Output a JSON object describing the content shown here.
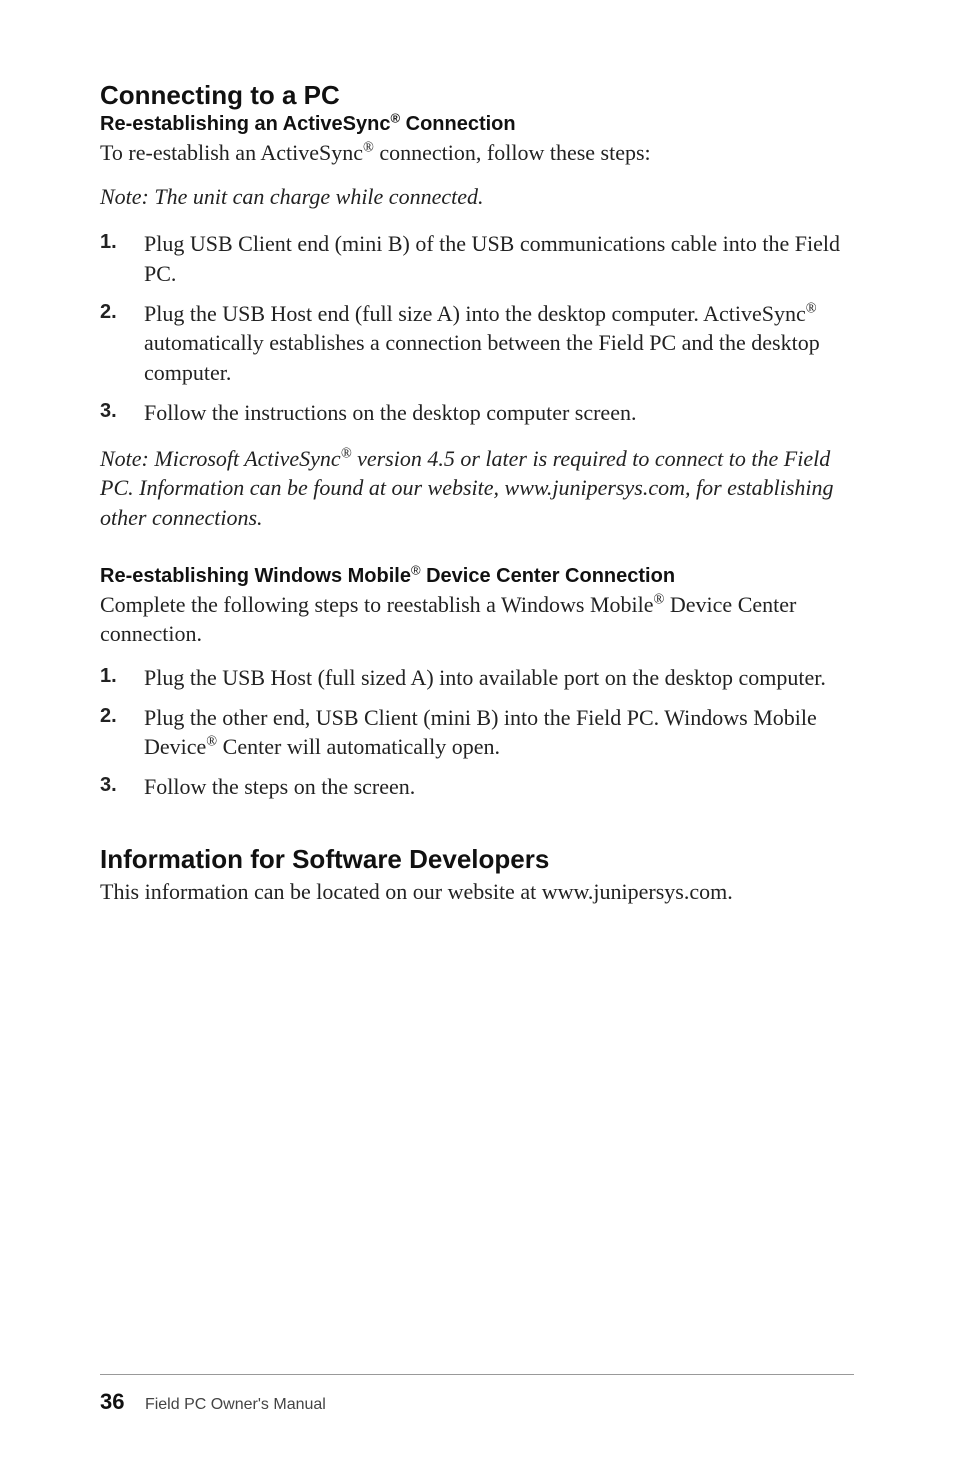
{
  "section1": {
    "title": "Connecting to a PC",
    "sub1": {
      "heading_pre": "Re-establishing an ActiveSync",
      "heading_post": " Connection",
      "intro_pre": "To re-establish an ActiveSync",
      "intro_post": " connection, follow these steps:",
      "note": "Note: The unit can charge while connected.",
      "step1": "Plug USB Client end (mini B) of the USB communications cable into the Field PC.",
      "step2_pre": "Plug the USB Host end (full size A) into the desktop computer. ActiveSync",
      "step2_post": " automatically establishes a connection between the Field PC and the desktop computer.",
      "step3": "Follow the instructions on the desktop computer screen.",
      "note2_pre": "Note: Microsoft ActiveSync",
      "note2_post": " version 4.5 or later is required to connect to the Field PC. Information can be found at our website, www.junipersys.com, for establishing other connections."
    },
    "sub2": {
      "heading_pre": "Re-establishing Windows Mobile",
      "heading_post": " Device Center Connection",
      "intro_pre": "Complete the following steps to reestablish a Windows Mobile",
      "intro_post": " Device Center connection.",
      "step1": "Plug the USB Host (full sized A) into available port on the desktop computer.",
      "step2_pre": "Plug the other end, USB Client (mini B) into the Field PC. Windows Mobile Device",
      "step2_post": " Center will automatically open.",
      "step3": "Follow the steps on the screen."
    }
  },
  "section2": {
    "title": "Information for Software Developers",
    "body": "This information can be located on our website at www.junipersys.com."
  },
  "footer": {
    "page": "36",
    "manual": "Field PC Owner's Manual"
  },
  "reg": "®"
}
